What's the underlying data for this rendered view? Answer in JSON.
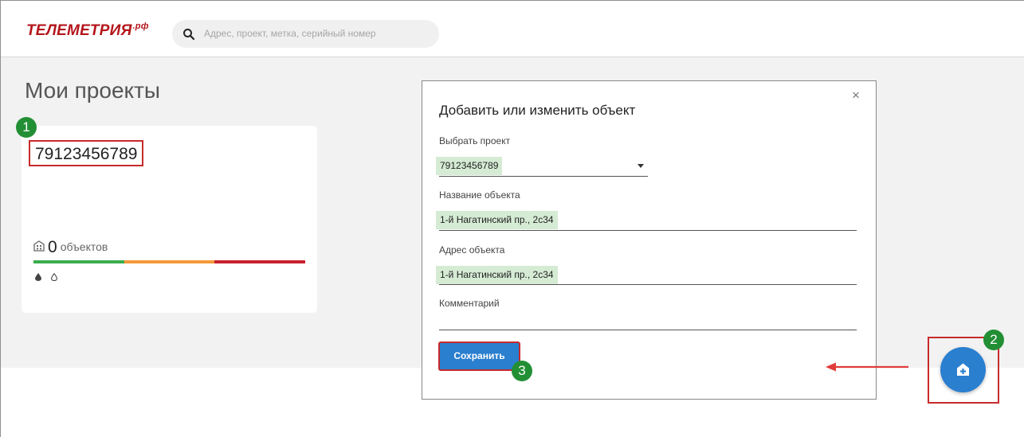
{
  "header": {
    "logo_text": "ТЕЛЕМЕТРИЯ",
    "logo_suffix": ".рф",
    "search_placeholder": "Адрес, проект, метка, серийный номер"
  },
  "page": {
    "title": "Мои проекты"
  },
  "project_card": {
    "phone": "79123456789",
    "objects_count": "0",
    "objects_label": "объектов"
  },
  "annotations": {
    "step1": "1",
    "step2": "2",
    "step3": "3"
  },
  "modal": {
    "title": "Добавить или изменить объект",
    "close": "×",
    "project_label": "Выбрать проект",
    "project_value": "79123456789",
    "name_label": "Название объекта",
    "name_value": "1-й Нагатинский пр., 2с34",
    "address_label": "Адрес объекта",
    "address_value": "1-й Нагатинский пр., 2с34",
    "comment_label": "Комментарий",
    "comment_value": "",
    "save_label": "Сохранить"
  },
  "colors": {
    "brand_red": "#b3151b",
    "primary_blue": "#2a7fcf",
    "highlight_green": "#d5ebd4",
    "badge_green": "#238f35",
    "bar_green": "#3aad4d",
    "bar_orange": "#f39a3a",
    "bar_red": "#c8202e",
    "annotation_red": "#c72b2b"
  },
  "icons": {
    "search": "search-icon",
    "building": "building-icon",
    "drop_filled": "drop-filled-icon",
    "drop_outline": "drop-outline-icon",
    "add_home": "add-home-icon",
    "close": "close-icon",
    "dropdown": "chevron-down-icon"
  }
}
